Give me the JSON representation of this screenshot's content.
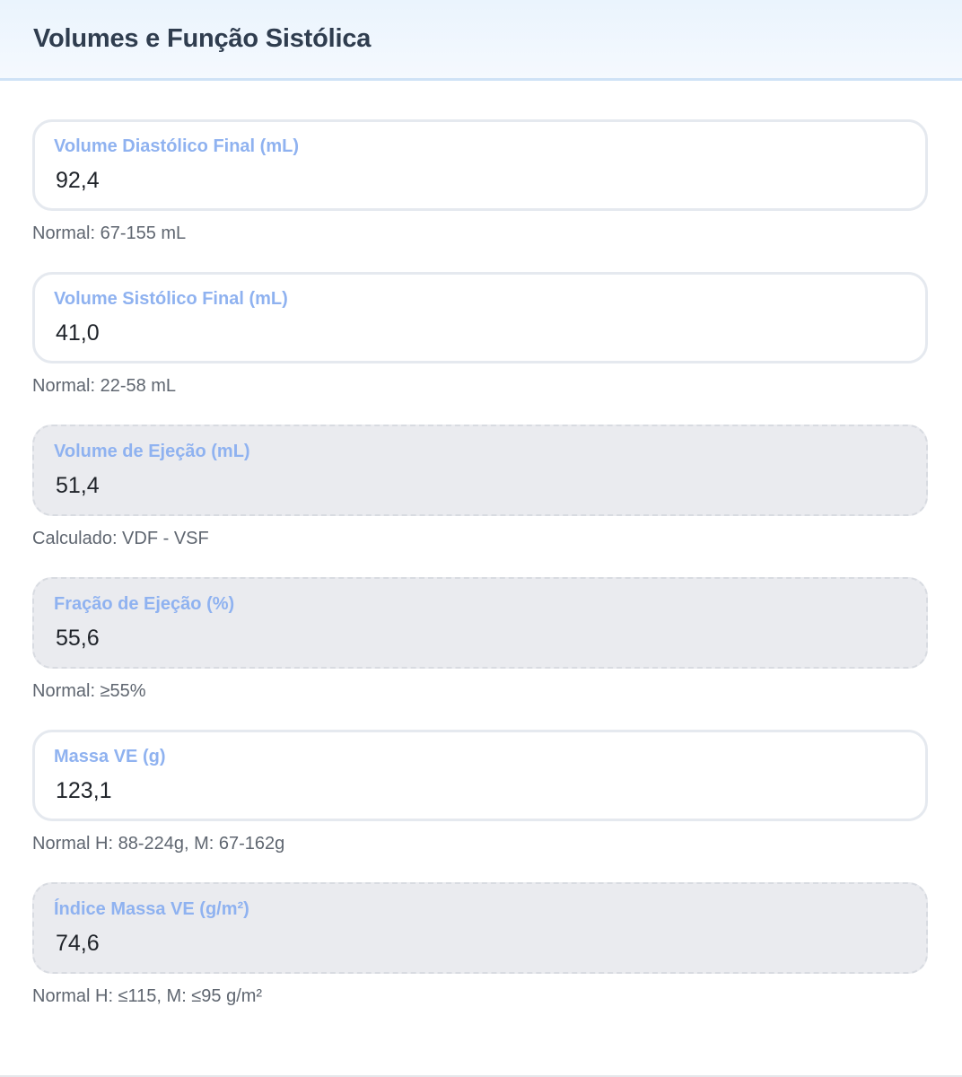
{
  "section": {
    "title": "Volumes e Função Sistólica"
  },
  "fields": [
    {
      "label": "Volume Diastólico Final (mL)",
      "value": "92,4",
      "hint": "Normal: 67-155 mL",
      "readonly": false
    },
    {
      "label": "Volume Sistólico Final (mL)",
      "value": "41,0",
      "hint": "Normal: 22-58 mL",
      "readonly": false
    },
    {
      "label": "Volume de Ejeção (mL)",
      "value": "51,4",
      "hint": "Calculado: VDF - VSF",
      "readonly": true
    },
    {
      "label": "Fração de Ejeção (%)",
      "value": "55,6",
      "hint": "Normal: ≥55%",
      "readonly": true
    },
    {
      "label": "Massa VE (g)",
      "value": "123,1",
      "hint": "Normal H: 88-224g, M: 67-162g",
      "readonly": false
    },
    {
      "label": "Índice Massa VE (g/m²)",
      "value": "74,6",
      "hint": "Normal H: ≤115, M: ≤95 g/m²",
      "readonly": true
    }
  ],
  "colors": {
    "label": "#8fb2f0",
    "value": "#1f2329",
    "hint": "#5f6670",
    "title": "#2f3d4f",
    "readonly_bg": "#eaebef"
  }
}
